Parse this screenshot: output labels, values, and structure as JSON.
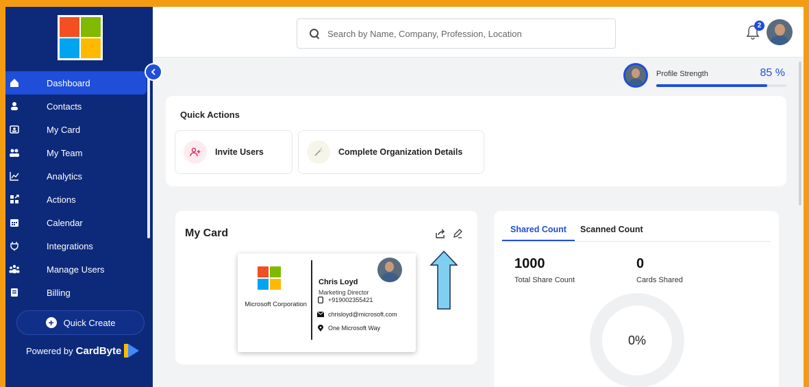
{
  "sidebar": {
    "items": [
      {
        "label": "Dashboard",
        "icon": "home-icon",
        "active": true
      },
      {
        "label": "Contacts",
        "icon": "person-icon"
      },
      {
        "label": "My Card",
        "icon": "id-card-icon"
      },
      {
        "label": "My Team",
        "icon": "team-icon"
      },
      {
        "label": "Analytics",
        "icon": "chart-line-icon"
      },
      {
        "label": "Actions",
        "icon": "actions-icon"
      },
      {
        "label": "Calendar",
        "icon": "calendar-icon"
      },
      {
        "label": "Integrations",
        "icon": "plug-icon"
      },
      {
        "label": "Manage Users",
        "icon": "users-icon"
      },
      {
        "label": "Billing",
        "icon": "billing-icon"
      }
    ],
    "quick_create": "Quick Create",
    "powered_prefix": "Powered by",
    "powered_brand": "CardByte"
  },
  "header": {
    "search_placeholder": "Search by Name, Company, Profession, Location",
    "notification_count": "2"
  },
  "profile_strength": {
    "label": "Profile Strength",
    "value_text": "85 %",
    "value": 85
  },
  "quick_actions": {
    "title": "Quick Actions",
    "invite": "Invite Users",
    "complete_org": "Complete Organization Details"
  },
  "my_card": {
    "title": "My Card",
    "company": "Microsoft Corporation",
    "name": "Chris Loyd",
    "role": "Marketing Director",
    "phone": "+919002355421",
    "email": "chrisloyd@microsoft.com",
    "address": "One Microsoft Way"
  },
  "stats": {
    "tab_shared": "Shared Count",
    "tab_scanned": "Scanned Count",
    "total_share_value": "1000",
    "total_share_label": "Total Share Count",
    "cards_shared_value": "0",
    "cards_shared_label": "Cards Shared",
    "percent": "0%"
  },
  "colors": {
    "sidebar_bg": "#0d2a7a",
    "accent": "#1f4fd8",
    "frame": "#f39c12"
  }
}
